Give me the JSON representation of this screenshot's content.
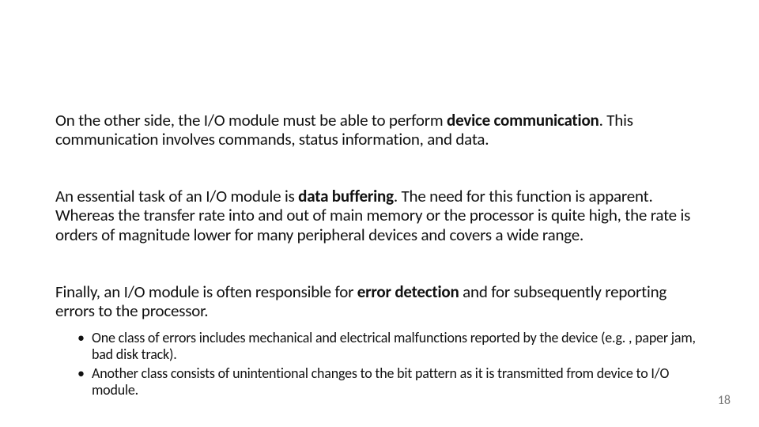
{
  "paragraphs": {
    "p1": {
      "pre": "On the other side, the I/O module must be able to perform ",
      "bold": "device communication",
      "post": ". This communication involves commands, status information, and data."
    },
    "p2": {
      "pre": "An essential task of an I/O module is ",
      "bold": "data buffering",
      "post": ". The need for this function is apparent. Whereas the transfer rate into and out of main memory or the processor is quite high, the rate is orders of magnitude lower for many peripheral devices and covers a wide range."
    },
    "p3": {
      "pre": "Finally, an I/O module is often responsible for ",
      "bold": "error detection",
      "post": " and for subsequently reporting errors to the processor."
    }
  },
  "bullets": [
    "One class of errors includes mechanical and electrical malfunctions reported by the device (e.g. , paper jam, bad disk track).",
    "Another class consists of unintentional changes to the bit pattern as it is transmitted from device to I/O module."
  ],
  "page_number": "18"
}
